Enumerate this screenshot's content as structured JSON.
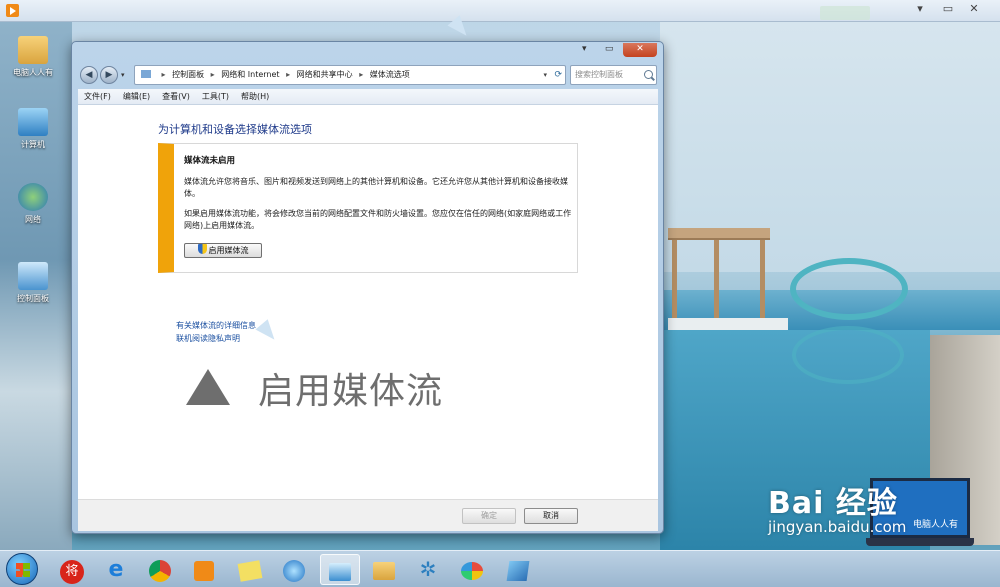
{
  "desktop": {
    "icons": [
      {
        "label": "电脑人人有"
      },
      {
        "label": "计算机"
      },
      {
        "label": "网络"
      },
      {
        "label": "控制面板"
      }
    ]
  },
  "window": {
    "address": {
      "crumbs": [
        "控制面板",
        "网络和 Internet",
        "网络和共享中心",
        "媒体流选项"
      ]
    },
    "search_placeholder": "搜索控制面板",
    "menu": [
      "文件(F)",
      "编辑(E)",
      "查看(V)",
      "工具(T)",
      "帮助(H)"
    ],
    "heading": "为计算机和设备选择媒体流选项",
    "notice": {
      "title": "媒体流未启用",
      "para1": "媒体流允许您将音乐、图片和视频发送到网络上的其他计算机和设备。它还允许您从其他计算机和设备接收媒体。",
      "para2": "如果启用媒体流功能，将会修改您当前的网络配置文件和防火墙设置。您应仅在信任的网络(如家庭网络或工作网络)上启用媒体流。",
      "button": "启用媒体流"
    },
    "links": [
      "有关媒体流的详细信息",
      "联机阅读隐私声明"
    ],
    "footer": {
      "ok": "确定",
      "cancel": "取消"
    }
  },
  "overlay": {
    "caption": "启用媒体流",
    "watermark_brand": "Bai 经验",
    "watermark_url": "jingyan.baidu.com",
    "laptop_caption": "电脑人人有"
  },
  "taskbar": {
    "items": [
      "start",
      "将",
      "internet-explorer",
      "chrome",
      "media-player",
      "sticky-notes",
      "network",
      "control-panel",
      "explorer",
      "settings",
      "paint",
      "network-map"
    ],
    "active_index": 7
  },
  "colors": {
    "accent_bar": "#f0a30a",
    "link": "#1a4fa0",
    "heading": "#1e3a8a"
  }
}
